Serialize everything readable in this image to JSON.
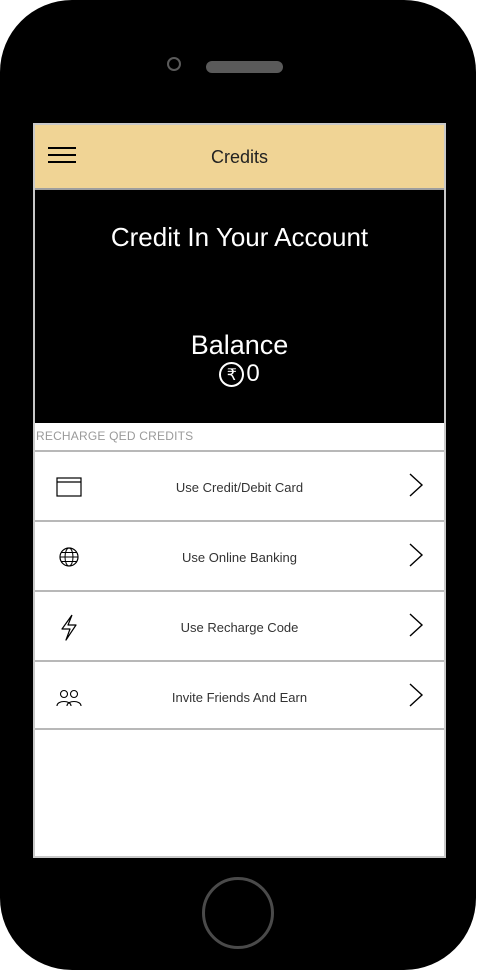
{
  "header": {
    "title": "Credits",
    "menu_icon": "hamburger-menu-icon",
    "background": "#f0d495"
  },
  "balance": {
    "heading": "Credit In Your Account",
    "label": "Balance",
    "currency_symbol": "₹",
    "amount": "0"
  },
  "recharge": {
    "section_label": "RECHARGE QED CREDITS",
    "options": [
      {
        "label": "Use Credit/Debit Card",
        "icon": "card-icon"
      },
      {
        "label": "Use Online Banking",
        "icon": "globe-icon"
      },
      {
        "label": "Use Recharge Code",
        "icon": "lightning-icon"
      },
      {
        "label": "Invite Friends And Earn",
        "icon": "people-icon"
      }
    ]
  },
  "colors": {
    "accent": "#f0d495",
    "panel": "#000000",
    "text": "#333333"
  }
}
